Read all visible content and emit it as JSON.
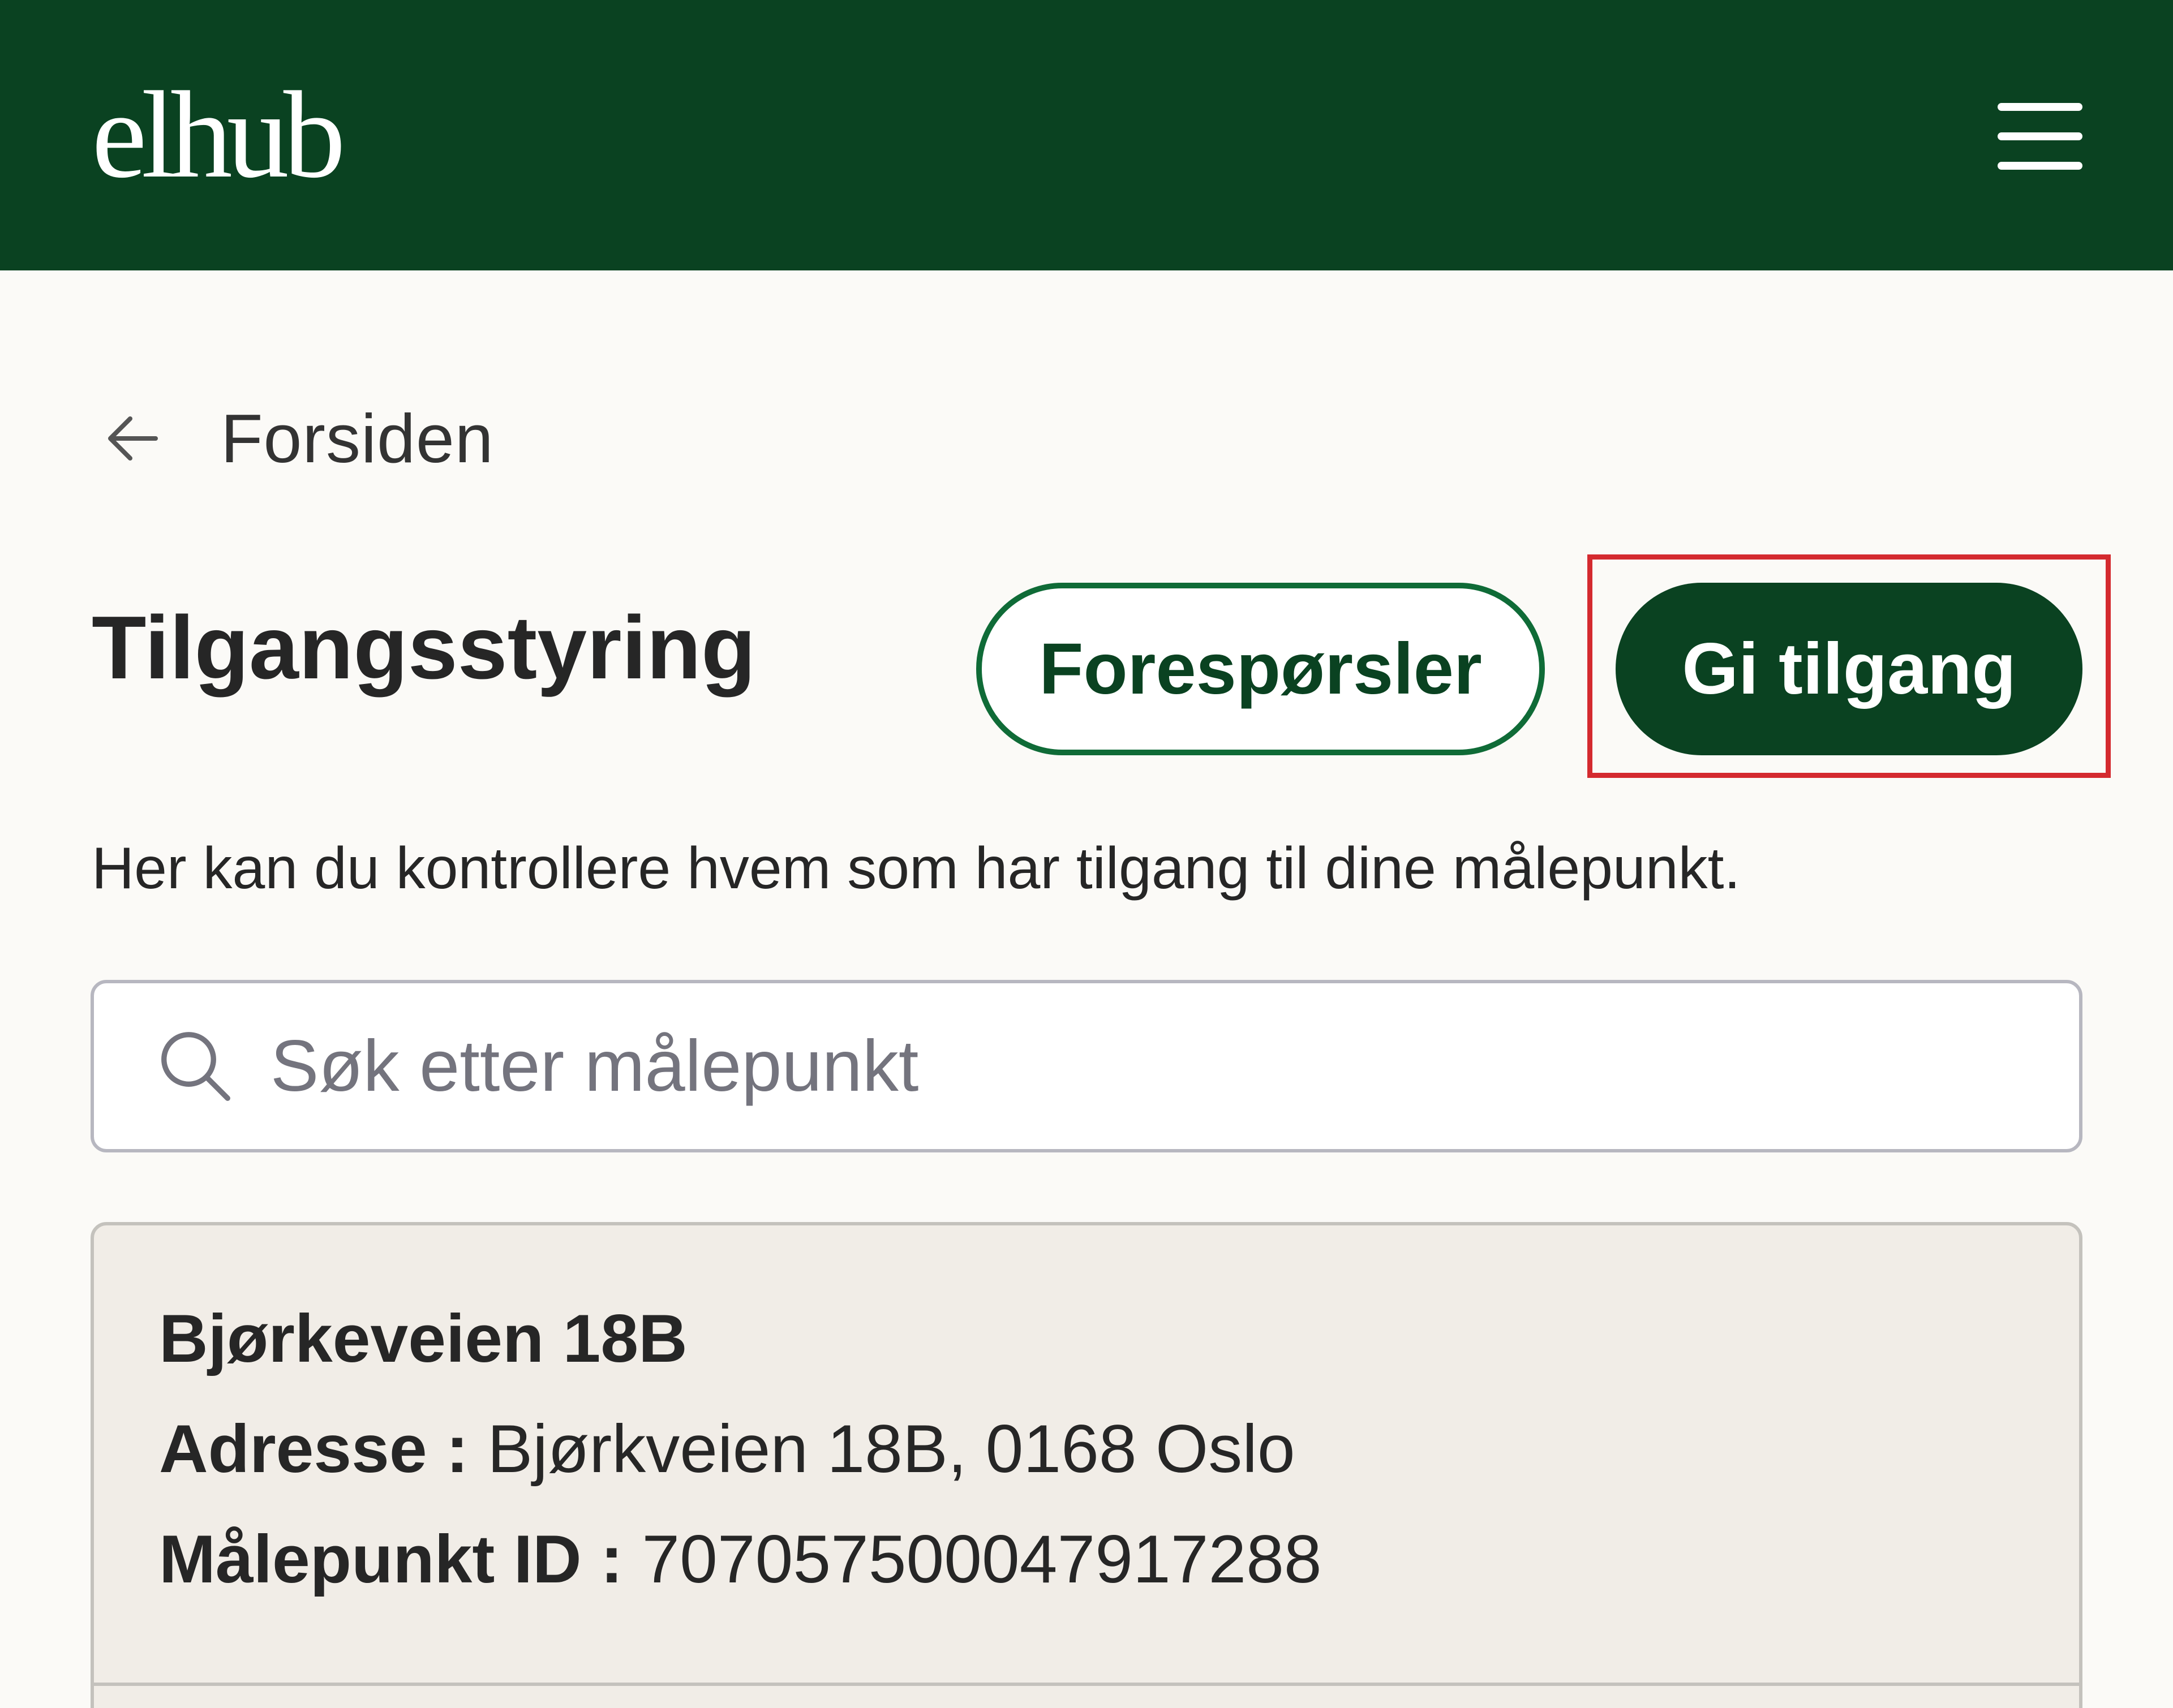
{
  "header": {
    "logo_text": "elhub",
    "menu_icon": "hamburger-menu-icon",
    "background_color": "#0a4221"
  },
  "back_link": {
    "icon": "arrow-left-icon",
    "label": "Forsiden"
  },
  "page": {
    "title": "Tilgangsstyring",
    "description": "Her kan du kontrollere hvem som har tilgang til dine målepunkt."
  },
  "actions": {
    "requests_label": "Forespørsler",
    "grant_access_label": "Gi tilgang",
    "highlight_color": "#d42a2f"
  },
  "search": {
    "icon": "search-icon",
    "placeholder": "Søk etter målepunkt",
    "value": ""
  },
  "meter_points": [
    {
      "name": "Bjørkeveien 18B",
      "address_label": "Adresse :",
      "address_value": "Bjørkveien 18B, 0168 Oslo",
      "id_label": "Målepunkt ID :",
      "id_value": "707057500047917288"
    }
  ],
  "colors": {
    "brand_green": "#0a4221",
    "outline_green": "#0f6b37",
    "page_background": "#fbfaf7",
    "card_background": "#f1ede7"
  }
}
